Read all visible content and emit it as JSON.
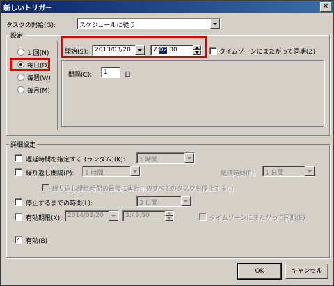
{
  "window": {
    "title": "新しいトリガー",
    "close_glyph": "✕"
  },
  "task_start": {
    "label": "タスクの開始(G):",
    "value": "スケジュールに従う"
  },
  "settings": {
    "label": "設定",
    "radios": [
      {
        "label": "1 回(N)",
        "selected": false
      },
      {
        "label": "毎日(D)",
        "selected": true
      },
      {
        "label": "毎週(W)",
        "selected": false
      },
      {
        "label": "毎月(M)",
        "selected": false
      }
    ],
    "start_label": "開始(S):",
    "start_date": "2013/03/20",
    "start_time_pre": "7:",
    "start_time_sel": "02",
    "start_time_post": ":00",
    "sync_tz_label": "タイムゾーンにまたがって同期(Z)",
    "interval_label": "間隔(C):",
    "interval_value": "1",
    "interval_unit": "日"
  },
  "advanced": {
    "label": "詳細設定",
    "delay_label": "遅延時間を指定する (ランダム)(K):",
    "delay_value": "1 時間",
    "repeat_label": "繰り返し間隔(P):",
    "repeat_value": "1 時間",
    "duration_label": "継続時間(F):",
    "duration_value": "1 日間",
    "stop_all_label": "繰り返し継続時間の最後に実行中のすべてのタスクを停止する(I)",
    "stop_after_label": "停止するまでの時間(L):",
    "stop_after_value": "3 日間",
    "expire_label": "有効期限(X):",
    "expire_date": "2014/03/20",
    "expire_time": "3:49:50",
    "expire_sync_label": "タイムゾーンにまたがって同期(E)",
    "enabled_label": "有効(B)",
    "check_glyph": "✓"
  },
  "buttons": {
    "ok": "OK",
    "cancel": "キャンセル"
  },
  "colors": {
    "highlight": "#e00000",
    "titlebar": "#0a246a"
  }
}
